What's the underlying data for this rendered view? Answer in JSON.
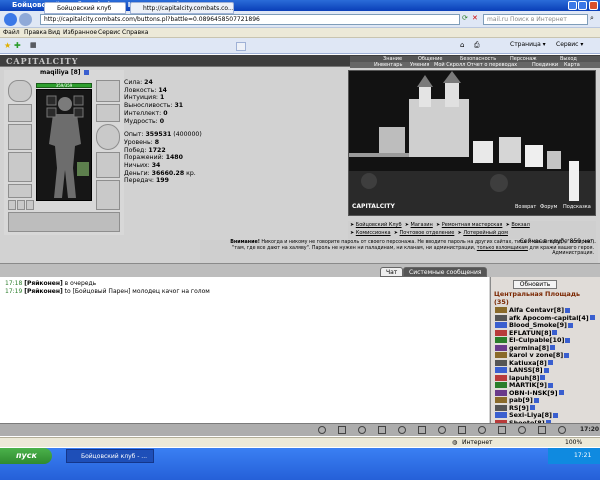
{
  "window": {
    "title": "Бойцовский клуб - Windows Internet Explorer"
  },
  "addressbar": {
    "url": "http://capitalcity.combats.com/buttons.pl?battle=0.0896458507721896",
    "search_placeholder": "mail.ru Поиск в Интернет"
  },
  "menu": [
    "Файл",
    "Правка",
    "Вид",
    "Избранное",
    "Сервис",
    "Справка"
  ],
  "tabs": [
    {
      "label": "Бойцовский клуб",
      "active": true
    },
    {
      "label": "http://capitalcity.combats.co...",
      "active": false
    }
  ],
  "tab_toolbar": {
    "page": "Страница",
    "tools": "Сервис"
  },
  "game": {
    "logo": "CAPITALCITY",
    "nav_top": [
      "Знание",
      "Общение",
      "Безопасность",
      "Персонаж",
      "Выход"
    ],
    "nav_bottom": [
      "Инвентарь",
      "Умения",
      "Мой Скролл",
      "Отчет о переводах",
      "Поединки",
      "Карта"
    ],
    "character": {
      "name": "maqiliya",
      "level": "[8]",
      "hp": "359/359",
      "stats": [
        {
          "label": "Сила:",
          "value": "24"
        },
        {
          "label": "Ловкость:",
          "value": "14"
        },
        {
          "label": "Интуиция:",
          "value": "1"
        },
        {
          "label": "Выносливость:",
          "value": "31"
        },
        {
          "label": "Интеллект:",
          "value": "0"
        },
        {
          "label": "Мудрость:",
          "value": "0"
        }
      ],
      "info": [
        {
          "label": "Опыт:",
          "value": "359531",
          "extra": "(400000)"
        },
        {
          "label": "Уровень:",
          "value": "8",
          "extra": ""
        },
        {
          "label": "Побед:",
          "value": "1722",
          "extra": ""
        },
        {
          "label": "Поражений:",
          "value": "1480",
          "extra": ""
        },
        {
          "label": "Ничьих:",
          "value": "34",
          "extra": ""
        },
        {
          "label": "Деньги:",
          "value": "36660.28",
          "extra": "кр."
        },
        {
          "label": "Передач:",
          "value": "199",
          "extra": ""
        }
      ]
    },
    "scene": {
      "title": "CAPITALCITY",
      "links": [
        "Возврат",
        "Форум",
        "Подсказка"
      ]
    },
    "city_links_row1": [
      "Бойцовский Клуб",
      "Магазин",
      "Ремонтная мастерская",
      "Вокзал"
    ],
    "city_links_row2": [
      "Комиссионка",
      "Почтовое отделение",
      "Лотерейный дом"
    ],
    "warning": {
      "title": "Внимание!",
      "line1": "Никогда и никому не говорите пароль от своего персонажа. Не вводите пароль на других сайтах, типа \"новый город\", \"лотерея\",",
      "line2": "\"там, где все дают на халяву\". Пароль не нужен ни паладинам, ни кланам, ни администрации,",
      "link": "только взломщикам",
      "line3": "для кражи вашего героя.",
      "footer": "Администрация."
    },
    "online": "Сейчас в клубе 859 чел.",
    "chat_tabs": [
      "Чат",
      "Системные сообщения"
    ],
    "chat": [
      {
        "time": "17:18",
        "who": "[Ряйконен]",
        "text": "в очередь"
      },
      {
        "time": "17:19",
        "who": "[Ряйконен]",
        "text": "to [Бойцовый Парен] молодец качог на голом"
      }
    ],
    "users_panel": {
      "refresh": "Обновить",
      "room": "Центральная Площадь",
      "count": "(35)",
      "users": [
        {
          "name": "Alfa Centavr",
          "level": "[8]"
        },
        {
          "name": "afk Apocom-capital",
          "level": "[4]"
        },
        {
          "name": "Blood_Smoke",
          "level": "[9]"
        },
        {
          "name": "EFLATUN",
          "level": "[8]"
        },
        {
          "name": "El-Culpable",
          "level": "[10]"
        },
        {
          "name": "germina",
          "level": "[8]"
        },
        {
          "name": "karol v zone",
          "level": "[8]"
        },
        {
          "name": "Katiuxa",
          "level": "[8]"
        },
        {
          "name": "LANSS",
          "level": "[8]"
        },
        {
          "name": "lapuh",
          "level": "[8]"
        },
        {
          "name": "MARTIK",
          "level": "[9]"
        },
        {
          "name": "OBN-I-NSK",
          "level": "[9]"
        },
        {
          "name": "pab",
          "level": "[9]"
        },
        {
          "name": "RS",
          "level": "[9]"
        },
        {
          "name": "Sexi-Liya",
          "level": "[8]"
        },
        {
          "name": "Shooto",
          "level": "[8]"
        }
      ]
    },
    "clock": "17:20"
  },
  "statusbar": {
    "zone": "Интернет",
    "zoom": "100%"
  },
  "taskbar": {
    "start": "пуск",
    "item": "Бойцовский клуб - ...",
    "time": "17:21"
  },
  "colors": {
    "xp_blue": "#1f3fd6",
    "accent_green": "#2a7d2a",
    "room_title": "#7a2600"
  }
}
